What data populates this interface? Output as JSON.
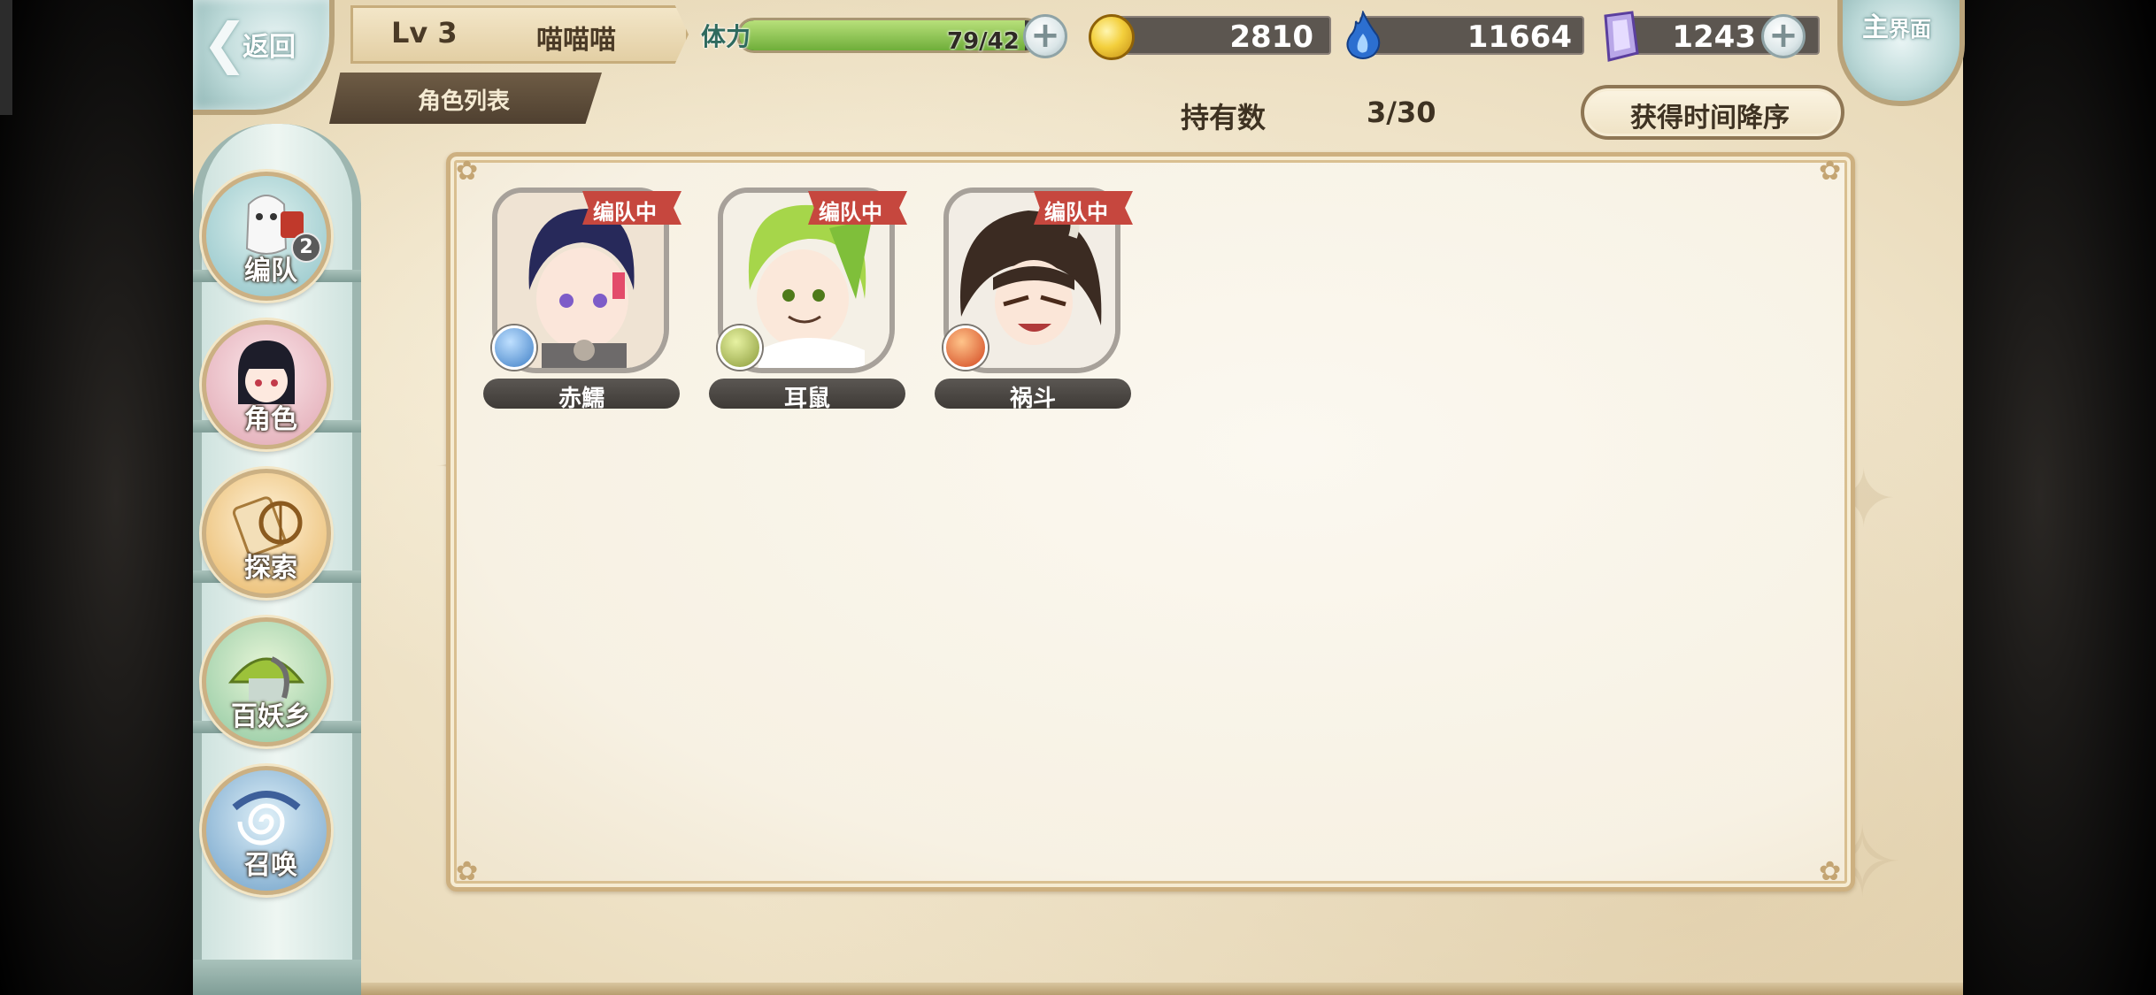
{
  "header": {
    "back_label": "返回",
    "level": "Lv 3",
    "player_name": "喵喵喵",
    "tab_label": "角色列表",
    "stamina": {
      "label": "体力",
      "current": 79,
      "max": 42,
      "text": "79/42",
      "fill_fraction": 0.95
    },
    "currencies": [
      {
        "name": "coin",
        "icon": "gold-coin-icon",
        "value": "2810"
      },
      {
        "name": "soul",
        "icon": "blue-flame-icon",
        "value": "11664"
      },
      {
        "name": "crystal",
        "icon": "purple-crystal-icon",
        "value": "1243"
      }
    ],
    "home_label_line1": "主",
    "home_label_line2": "界面"
  },
  "toolbar": {
    "count_label": "持有数",
    "count_value": "3/30",
    "sort_label": "获得时间降序"
  },
  "sidebar": {
    "items": [
      {
        "id": "team",
        "label": "编队",
        "badge": "2",
        "icon": "team-icon"
      },
      {
        "id": "character",
        "label": "角色",
        "icon": "character-icon"
      },
      {
        "id": "explore",
        "label": "探索",
        "icon": "explore-icon"
      },
      {
        "id": "village",
        "label": "百妖乡",
        "icon": "village-icon"
      },
      {
        "id": "summon",
        "label": "召唤",
        "icon": "summon-icon"
      }
    ]
  },
  "characters": [
    {
      "name": "赤鱬",
      "badge": "编队中",
      "element": "water",
      "element_color": "#3f7fc6"
    },
    {
      "name": "耳鼠",
      "badge": "编队中",
      "element": "wind",
      "element_color": "#8a9a3a"
    },
    {
      "name": "祸斗",
      "badge": "编队中",
      "element": "fire",
      "element_color": "#d2461f"
    }
  ],
  "colors": {
    "parchment": "#efe3c8",
    "badge_red": "#c6473e",
    "stamina_green": "#7fbc45",
    "text_dark": "#3e3222"
  }
}
